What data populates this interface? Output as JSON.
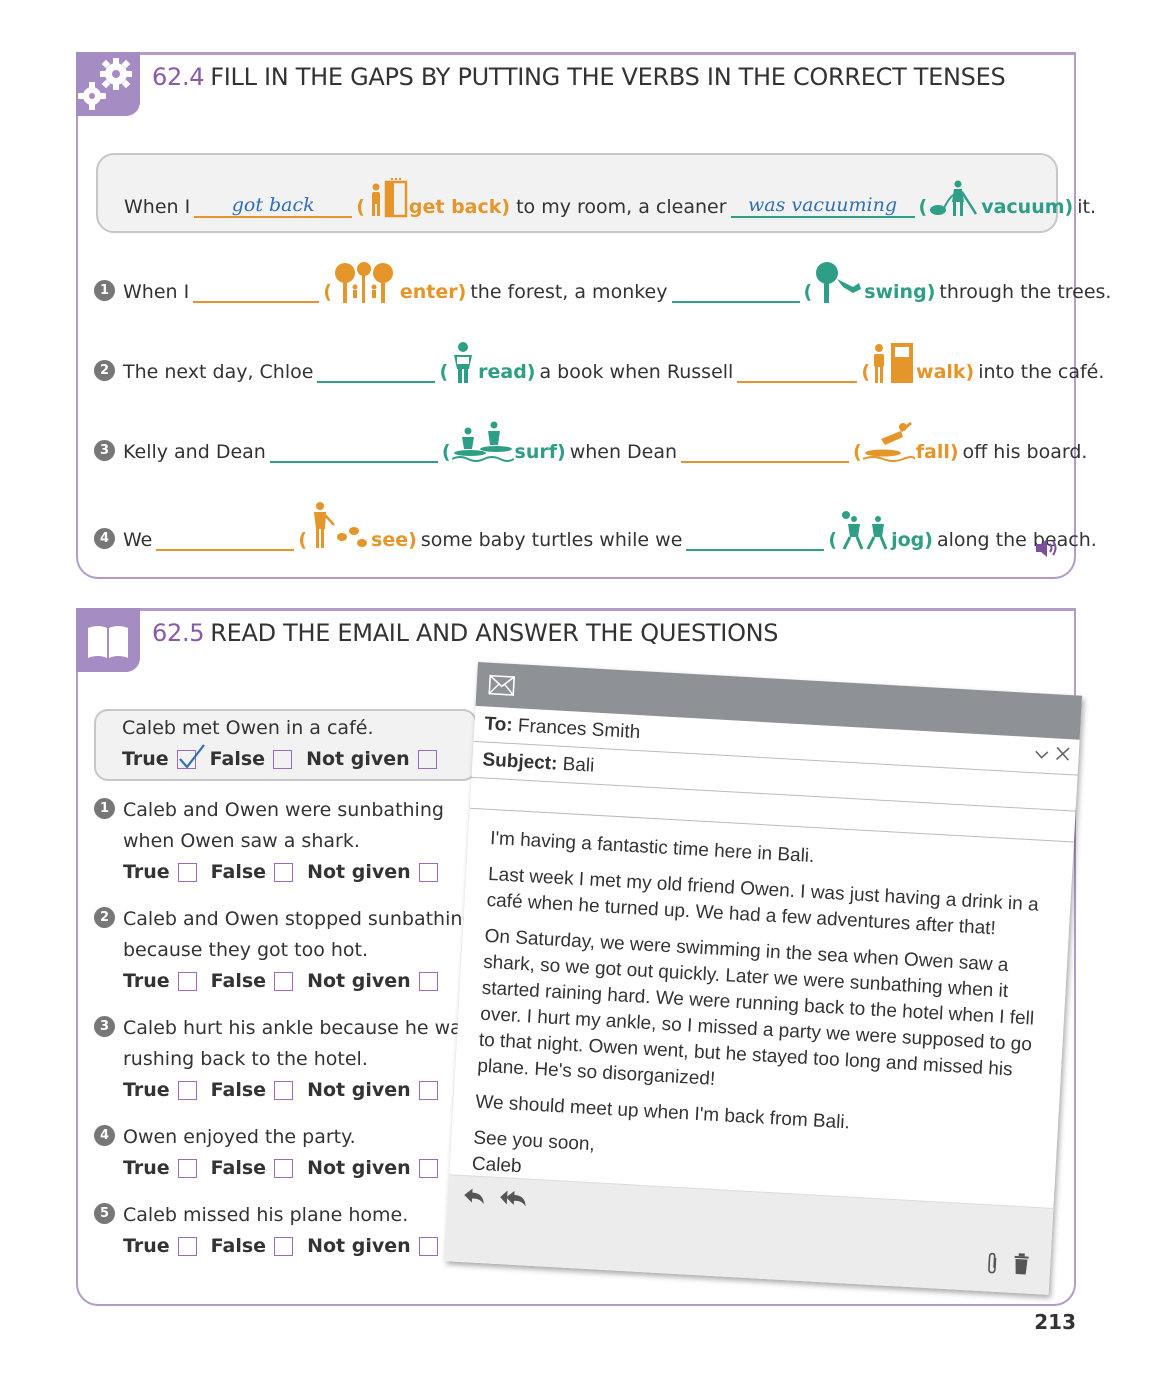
{
  "ex1": {
    "number": "62.4",
    "title": "FILL IN THE GAPS BY PUTTING THE VERBS IN THE CORRECT TENSES",
    "example": {
      "pre": "When I",
      "answer1": "got back",
      "verb1": "get back)",
      "mid": "to my room, a cleaner",
      "answer2": "was vacuuming",
      "verb2": "vacuum)",
      "post": "it."
    },
    "items": [
      {
        "num": "1",
        "pre": "When I",
        "verb1": "enter)",
        "mid": "the forest, a monkey",
        "verb2": "swing)",
        "post": "through the trees."
      },
      {
        "num": "2",
        "pre": "The next day, Chloe",
        "verb1": "read)",
        "mid": "a book when Russell",
        "verb2": "walk)",
        "post": "into the café."
      },
      {
        "num": "3",
        "pre": "Kelly and Dean",
        "verb1": "surf)",
        "mid": "when Dean",
        "verb2": "fall)",
        "post": "off his board."
      },
      {
        "num": "4",
        "pre": "We",
        "verb1": "see)",
        "mid": "some baby turtles  while we",
        "verb2": "jog)",
        "post": "along the beach."
      }
    ]
  },
  "ex2": {
    "number": "62.5",
    "title": "READ THE EMAIL AND ANSWER THE QUESTIONS",
    "options": {
      "true": "True",
      "false": "False",
      "not_given": "Not given"
    },
    "example": {
      "line1": "Caleb met Owen in a café.",
      "answer": "True"
    },
    "questions": [
      {
        "num": "1",
        "line1": "Caleb and Owen were sunbathing",
        "line2": "when Owen saw a shark."
      },
      {
        "num": "2",
        "line1": "Caleb and Owen stopped sunbathing",
        "line2": "because they got too hot."
      },
      {
        "num": "3",
        "line1": "Caleb hurt his ankle because he was",
        "line2": "rushing back to the hotel."
      },
      {
        "num": "4",
        "line1": "Owen enjoyed the party."
      },
      {
        "num": "5",
        "line1": "Caleb missed his plane home."
      }
    ]
  },
  "email": {
    "to_label": "To:",
    "to_value": "Frances Smith",
    "subject_label": "Subject:",
    "subject_value": "Bali",
    "paragraphs": [
      "I'm having a fantastic time here in Bali.",
      "Last week I met my old friend Owen. I was just having a drink in a café when he turned up. We had a few adventures after that!",
      "On Saturday, we were swimming in the sea when Owen saw a shark, so we got out quickly. Later we were sunbathing when it started raining hard. We were running back to the hotel when I fell over. I hurt my ankle, so I missed a party we were supposed to go to that night. Owen went, but he stayed too long and missed his plane. He's so disorganized!",
      "We should meet up when I'm back from Bali.",
      "See you soon,\nCaleb"
    ]
  },
  "page_number": "213",
  "icons": [
    "gear-icon",
    "book-icon",
    "speaker-icon",
    "envelope-icon",
    "chevron-down-icon",
    "close-icon",
    "reply-icon",
    "reply-all-icon",
    "paperclip-icon",
    "trash-icon"
  ],
  "colors": {
    "accent": "#a58cc2",
    "orange": "#e5962a",
    "teal": "#2f9e86",
    "handwriting": "#2f6fb5"
  }
}
